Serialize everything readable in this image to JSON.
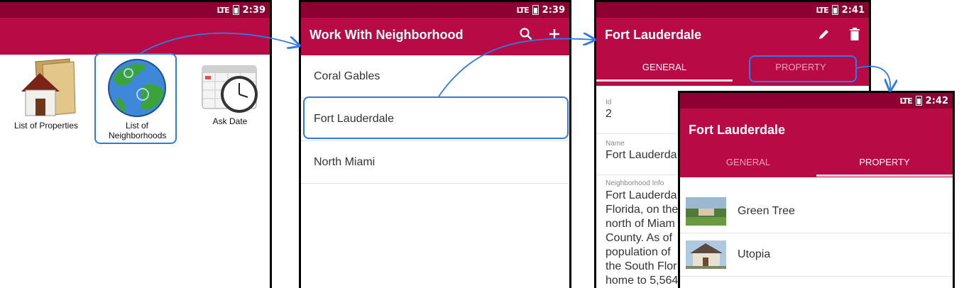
{
  "screen1": {
    "time": "2:39",
    "items": [
      {
        "label": "List of Properties",
        "icon": "house-folder-icon"
      },
      {
        "label": "List of Neighborhoods",
        "icon": "globe-icon"
      },
      {
        "label": "Ask Date",
        "icon": "calendar-clock-icon"
      }
    ]
  },
  "screen2": {
    "time": "2:39",
    "title": "Work With Neighborhood",
    "items": [
      "Coral Gables",
      "Fort Lauderdale",
      "North Miami"
    ]
  },
  "screen3": {
    "time": "2:41",
    "title": "Fort Lauderdale",
    "tabs": [
      "GENERAL",
      "PROPERTY"
    ],
    "fields": {
      "id_label": "Id",
      "id_value": "2",
      "name_label": "Name",
      "name_value": "Fort Lauderda",
      "info_label": "Neighborhood Info",
      "info_lines": [
        "Fort Lauderda",
        "Florida, on the",
        "north of Miam",
        "County. As of",
        "population of",
        "the South Flor",
        "home to 5,564"
      ]
    }
  },
  "screen4": {
    "time": "2:42",
    "title": "Fort Lauderdale",
    "tabs": [
      "GENERAL",
      "PROPERTY"
    ],
    "properties": [
      "Green Tree",
      "Utopia"
    ]
  },
  "status": {
    "network": "LTE"
  },
  "colors": {
    "primary": "#b80a45",
    "status_bar": "#8d0031",
    "highlight": "#2f7ae5"
  }
}
